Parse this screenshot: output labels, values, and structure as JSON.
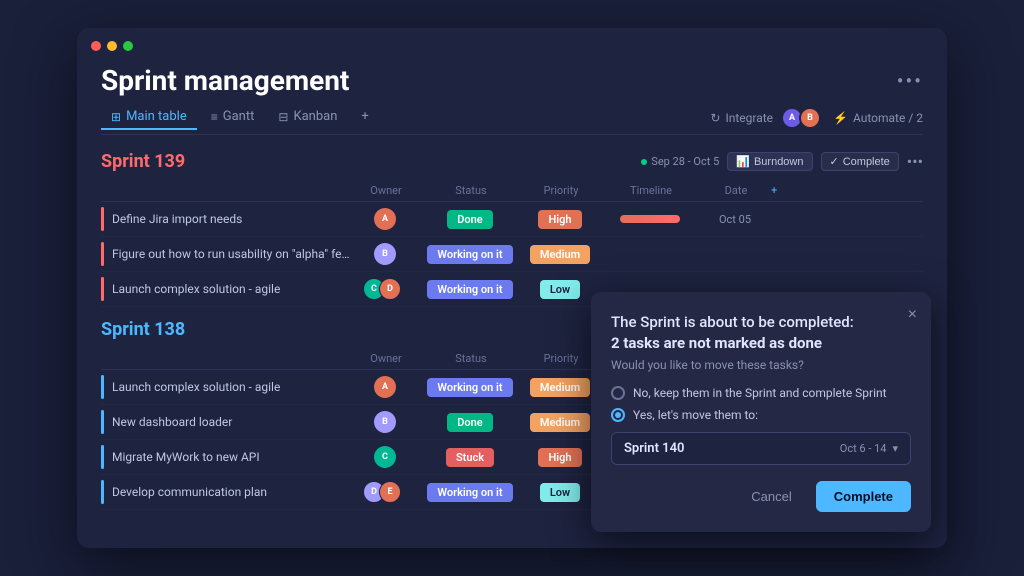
{
  "window": {
    "title": "Sprint management",
    "more_label": "•••",
    "dots": [
      "red",
      "yellow",
      "green"
    ]
  },
  "tabs": {
    "items": [
      {
        "id": "main-table",
        "label": "Main table",
        "active": true,
        "icon": "⊞"
      },
      {
        "id": "gantt",
        "label": "Gantt",
        "active": false,
        "icon": "≡"
      },
      {
        "id": "kanban",
        "label": "Kanban",
        "active": false,
        "icon": "⊟"
      },
      {
        "id": "add",
        "label": "+",
        "active": false,
        "icon": ""
      }
    ],
    "integrate_label": "Integrate",
    "automate_label": "Automate / 2"
  },
  "sprints": [
    {
      "id": "sprint-139",
      "title": "Sprint 139",
      "color": "red",
      "date_range": "Sep 28 - Oct 5",
      "burndown_label": "Burndown",
      "complete_label": "Complete",
      "columns": [
        "Owner",
        "Status",
        "Priority",
        "Timeline",
        "Date"
      ],
      "tasks": [
        {
          "name": "Define Jira import needs",
          "owner": "A",
          "owner_color": "orange",
          "status": "Done",
          "status_type": "done",
          "priority": "High",
          "priority_type": "high",
          "timeline": true,
          "date": "Oct 05"
        },
        {
          "name": "Figure out how to run usability on \"alpha\" feature",
          "owner": "B",
          "owner_color": "purple",
          "status": "Working on it",
          "status_type": "working",
          "priority": "Medium",
          "priority_type": "medium",
          "timeline": false,
          "date": ""
        },
        {
          "name": "Launch complex solution - agile",
          "owner_multi": [
            "C",
            "D"
          ],
          "owner_colors": [
            "teal",
            "orange"
          ],
          "status": "Working on it",
          "status_type": "working",
          "priority": "Low",
          "priority_type": "low",
          "timeline": false,
          "date": ""
        }
      ]
    },
    {
      "id": "sprint-138",
      "title": "Sprint 138",
      "color": "blue",
      "tasks": [
        {
          "name": "Launch complex solution - agile",
          "owner": "A",
          "owner_color": "orange",
          "status": "Working on it",
          "status_type": "working",
          "priority": "Medium",
          "priority_type": "medium"
        },
        {
          "name": "New dashboard loader",
          "owner": "B",
          "owner_color": "purple",
          "status": "Done",
          "status_type": "done",
          "priority": "Medium",
          "priority_type": "medium"
        },
        {
          "name": "Migrate MyWork to new API",
          "owner": "C",
          "owner_color": "teal",
          "status": "Stuck",
          "status_type": "stuck",
          "priority": "High",
          "priority_type": "high"
        },
        {
          "name": "Develop communication plan",
          "owner_multi": [
            "D",
            "E"
          ],
          "owner_colors": [
            "purple",
            "orange"
          ],
          "status": "Working on it",
          "status_type": "working",
          "priority": "Low",
          "priority_type": "low"
        }
      ]
    }
  ],
  "modal": {
    "title_prefix": "The Sprint is about to be completed:",
    "title_bold": "2 tasks are not marked as done",
    "subtitle": "Would you like to move these tasks?",
    "option_no": "No, keep them in the Sprint and complete Sprint",
    "option_yes": "Yes, let's move them to:",
    "sprint_name": "Sprint 140",
    "sprint_dates": "Oct 6 - 14",
    "cancel_label": "Cancel",
    "complete_label": "Complete",
    "close_label": "×"
  },
  "colors": {
    "done": "#00b884",
    "working": "#6c7af0",
    "stuck": "#e45f5f",
    "high": "#e17055",
    "medium": "#f4a261",
    "low": "#81ecec",
    "sprint139": "#ff6b6b",
    "sprint138": "#4db8ff",
    "accent": "#4db8ff"
  }
}
